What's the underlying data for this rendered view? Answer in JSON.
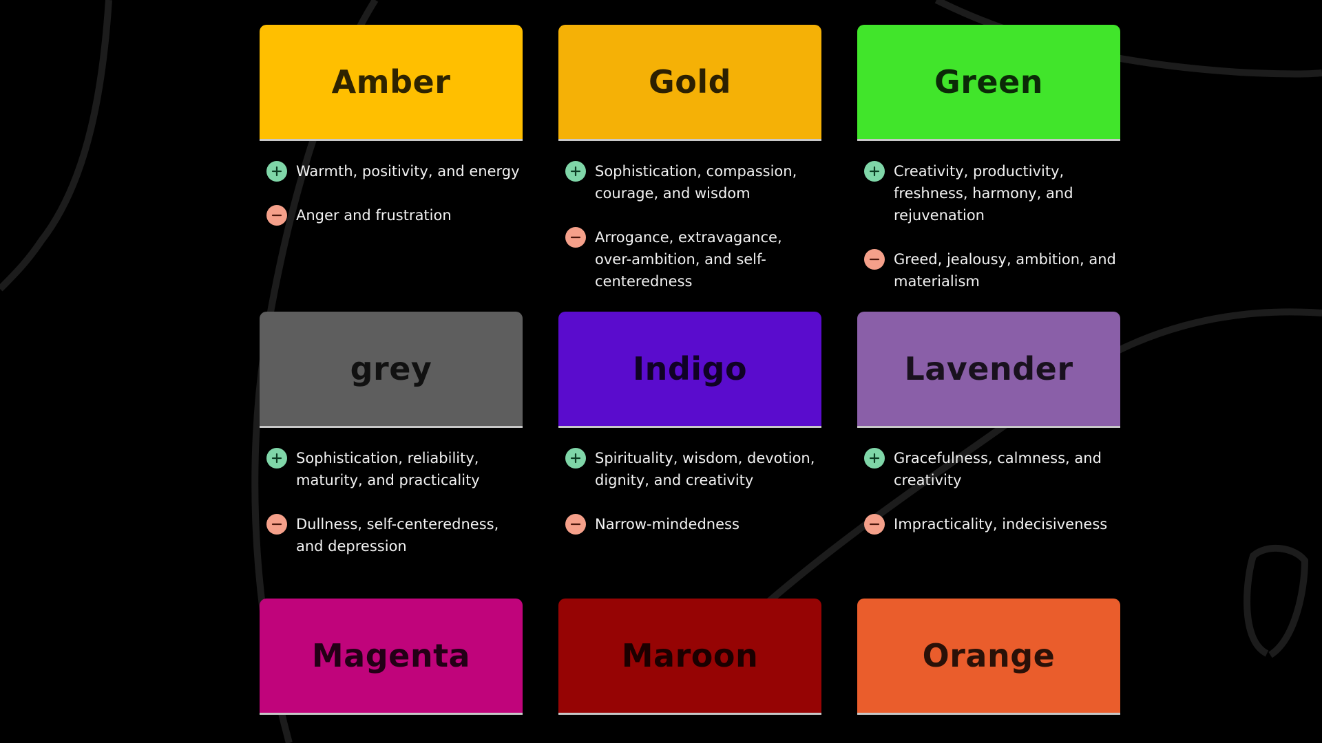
{
  "colors": [
    {
      "name": "Amber",
      "color": "#ffbf00",
      "positive": "Warmth, positivity, and energy",
      "negative": "Anger and frustration"
    },
    {
      "name": "Gold",
      "color": "#f5b106",
      "positive": "Sophistication, compassion, courage, and wisdom",
      "negative": "Arrogance, extravagance, over-ambition, and self-centeredness"
    },
    {
      "name": "Green",
      "color": "#41e52b",
      "positive": "Creativity, productivity, freshness, harmony, and rejuvenation",
      "negative": "Greed, jealousy, ambition, and materialism"
    },
    {
      "name": "grey",
      "color": "#5e5e5e",
      "positive": "Sophistication, reliability, maturity, and practicality",
      "negative": "Dullness, self-centeredness, and depression"
    },
    {
      "name": "Indigo",
      "color": "#5a0ccd",
      "positive": "Spirituality, wisdom, devotion, dignity, and creativity",
      "negative": "Narrow-mindedness"
    },
    {
      "name": "Lavender",
      "color": "#8a5fa8",
      "positive": "Gracefulness, calmness, and creativity",
      "negative": "Impracticality, indecisiveness"
    },
    {
      "name": "Magenta",
      "color": "#c0047b",
      "positive": "",
      "negative": ""
    },
    {
      "name": "Maroon",
      "color": "#960404",
      "positive": "",
      "negative": ""
    },
    {
      "name": "Orange",
      "color": "#ea5d2c",
      "positive": "",
      "negative": ""
    }
  ],
  "icons": {
    "positive": "plus-circle-icon",
    "negative": "minus-circle-icon"
  }
}
